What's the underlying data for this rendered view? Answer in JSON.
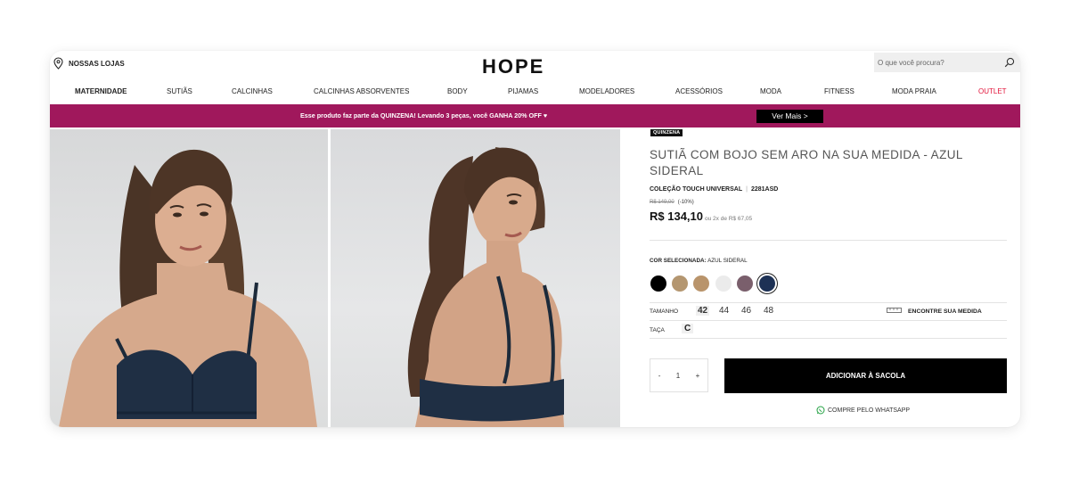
{
  "header": {
    "stores_label": "NOSSAS LOJAS",
    "logo": "HOPE",
    "search_placeholder": "O que você procura?"
  },
  "nav": {
    "items": [
      "MATERNIDADE",
      "SUTIÃS",
      "CALCINHAS",
      "CALCINHAS ABSORVENTES",
      "BODY",
      "PIJAMAS",
      "MODELADORES",
      "ACESSÓRIOS",
      "MODA",
      "FITNESS",
      "MODA PRAIA",
      "OUTLET"
    ]
  },
  "banner": {
    "text": "Esse produto faz parte da QUINZENA! Levando 3 peças, você GANHA 20% OFF ♥",
    "button": "Ver Mais >"
  },
  "product": {
    "tag": "QUINZENA",
    "title": "SUTIÃ COM BOJO SEM ARO NA SUA MEDIDA - AZUL SIDERAL",
    "collection": "COLEÇÃO TOUCH UNIVERSAL",
    "collection_sep": "|",
    "sku": "2281ASD",
    "old_price": "R$ 149,00",
    "discount": "(-10%)",
    "price": "R$ 134,10",
    "installments": "ou 2x de R$ 67,05",
    "color_label": "COR SELECIONADA:",
    "color_value": "AZUL SIDERAL",
    "swatches": [
      "#000000",
      "#b49670",
      "#b9946b",
      "#ebebeb",
      "#7a5f6c",
      "#1d3155"
    ],
    "size_label": "TAMANHO",
    "sizes": [
      "42",
      "44",
      "46",
      "48"
    ],
    "measure_label": "ENCONTRE SUA MEDIDA",
    "cup_label": "TAÇA",
    "cup": "C",
    "qty_minus": "-",
    "qty_value": "1",
    "qty_plus": "+",
    "add_button": "ADICIONAR À SACOLA",
    "whatsapp": "COMPRE PELO WHATSAPP"
  },
  "colors": {
    "banner": "#a0185c",
    "outlet": "#e2143a"
  }
}
